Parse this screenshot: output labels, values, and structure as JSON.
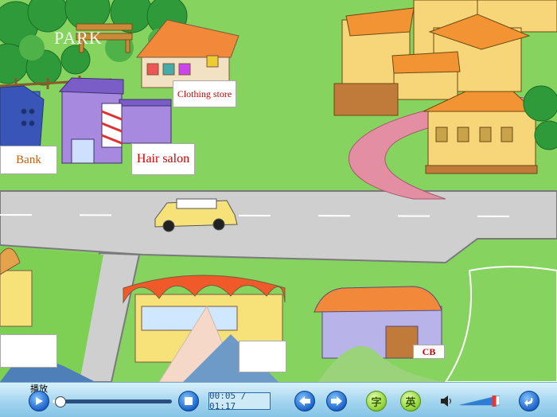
{
  "scene": {
    "park_label": "PARK",
    "clothing_store_sign": "Clothing store",
    "bank_sign": "Bank",
    "hair_salon_sign": "Hair salon",
    "partial_sign_right": "CB"
  },
  "toolbar": {
    "play_label": "播放",
    "time": "00:05 / 01:17",
    "char_button": "字",
    "english_button": "英",
    "progress": 0.06,
    "volume": 0.85
  }
}
